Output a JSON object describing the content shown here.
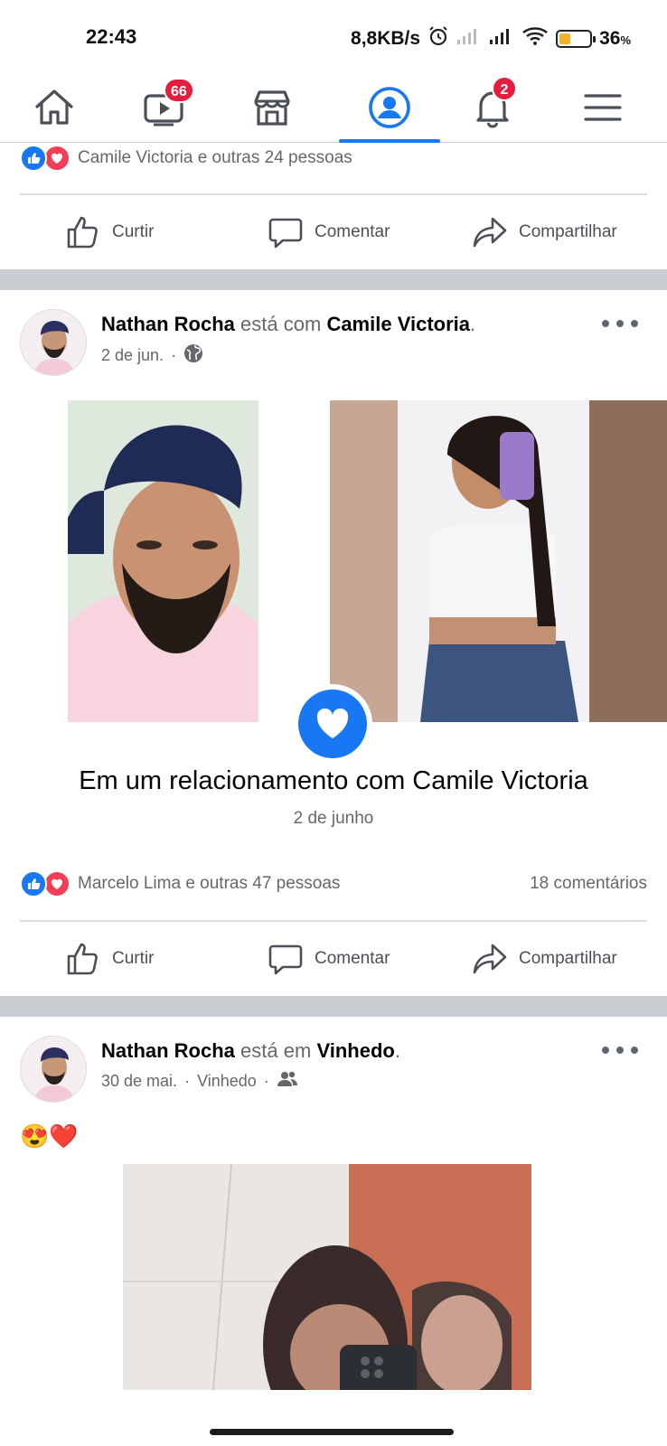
{
  "status_bar": {
    "time": "22:43",
    "network_speed": "8,8KB/s",
    "battery_percent": "36",
    "battery_symbol": "%",
    "battery_level": 0.36,
    "icons": [
      "alarm-icon",
      "signal-weak-icon",
      "signal-icon",
      "wifi-icon",
      "battery-icon"
    ]
  },
  "nav": {
    "items": [
      {
        "name": "home",
        "icon": "home-icon"
      },
      {
        "name": "watch",
        "icon": "video-icon",
        "badge": "66"
      },
      {
        "name": "marketplace",
        "icon": "store-icon"
      },
      {
        "name": "profile",
        "icon": "profile-icon",
        "active": true
      },
      {
        "name": "notifications",
        "icon": "bell-icon",
        "badge": "2"
      },
      {
        "name": "menu",
        "icon": "menu-icon"
      }
    ],
    "accent": "#1877f2"
  },
  "actions": {
    "like": "Curtir",
    "comment": "Comentar",
    "share": "Compartilhar"
  },
  "post0": {
    "reactions_text": "Camile Victoria e outras 24 pessoas"
  },
  "post1": {
    "author": "Nathan Rocha",
    "connector": "está com",
    "tagged": "Camile Victoria",
    "date": "2 de jun.",
    "dot": "·",
    "privacy_icon": "globe-icon",
    "relationship_title": "Em um relacionamento com Camile Victoria",
    "relationship_date": "2 de junho",
    "reactions_text": "Marcelo Lima e outras 47 pessoas",
    "comments_text": "18 comentários"
  },
  "post2": {
    "author": "Nathan Rocha",
    "connector": "está em",
    "place": "Vinhedo",
    "date": "30 de mai.",
    "location": "Vinhedo",
    "dot": "·",
    "privacy_icon": "friends-icon",
    "emoji_text": "😍❤️"
  },
  "colors": {
    "like_blue": "#1877f2",
    "love_red": "#f33e58",
    "badge_red": "#e41e3f",
    "muted_text": "#65676b"
  }
}
